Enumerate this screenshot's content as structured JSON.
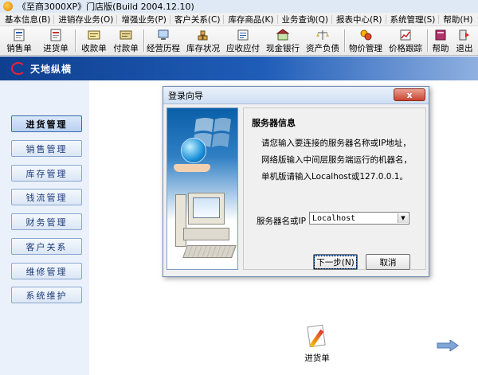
{
  "window": {
    "title": "《至商3000XP》门店版(Build 2004.12.10)"
  },
  "menu": [
    "基本信息(B)",
    "进销存业务(O)",
    "增强业务(P)",
    "客户关系(C)",
    "库存商品(K)",
    "业务查询(Q)",
    "报表中心(R)",
    "系统管理(S)",
    "帮助(H)"
  ],
  "toolbar": [
    {
      "label": "销售单",
      "icon": "sales-doc-icon"
    },
    {
      "label": "进货单",
      "icon": "purchase-doc-icon"
    },
    {
      "label": "收款单",
      "icon": "receipt-icon"
    },
    {
      "label": "付款单",
      "icon": "payment-icon"
    },
    {
      "label": "经营历程",
      "icon": "history-icon"
    },
    {
      "label": "库存状况",
      "icon": "inventory-icon"
    },
    {
      "label": "应收应付",
      "icon": "receivable-icon"
    },
    {
      "label": "现金银行",
      "icon": "cash-bank-icon"
    },
    {
      "label": "资产负债",
      "icon": "balance-icon"
    },
    {
      "label": "物价管理",
      "icon": "price-icon"
    },
    {
      "label": "价格跟踪",
      "icon": "price-track-icon"
    },
    {
      "label": "帮助",
      "icon": "help-book-icon"
    },
    {
      "label": "退出",
      "icon": "exit-icon"
    }
  ],
  "brand": {
    "name": "天地纵横"
  },
  "nav": [
    {
      "label": "进货管理",
      "active": true
    },
    {
      "label": "销售管理",
      "active": false
    },
    {
      "label": "库存管理",
      "active": false
    },
    {
      "label": "钱流管理",
      "active": false
    },
    {
      "label": "财务管理",
      "active": false
    },
    {
      "label": "客户关系",
      "active": false
    },
    {
      "label": "维修管理",
      "active": false
    },
    {
      "label": "系统维护",
      "active": false
    }
  ],
  "desktop": {
    "icon_label": "进货单"
  },
  "dialog": {
    "title": "登录向导",
    "close": "x",
    "section_title": "服务器信息",
    "lines": [
      "请您输入要连接的服务器名称或IP地址，",
      "网络版输入中间层服务端运行的机器名，",
      "单机版请输入Localhost或127.0.0.1。"
    ],
    "server_label": "服务器名或IP",
    "server_value": "Localhost",
    "next_button": "下一步(N)",
    "cancel_button": "取消"
  },
  "colors": {
    "brand_dark": "#0f3f8f",
    "nav_bg": "#eaf1fb",
    "close_red": "#c94430"
  }
}
